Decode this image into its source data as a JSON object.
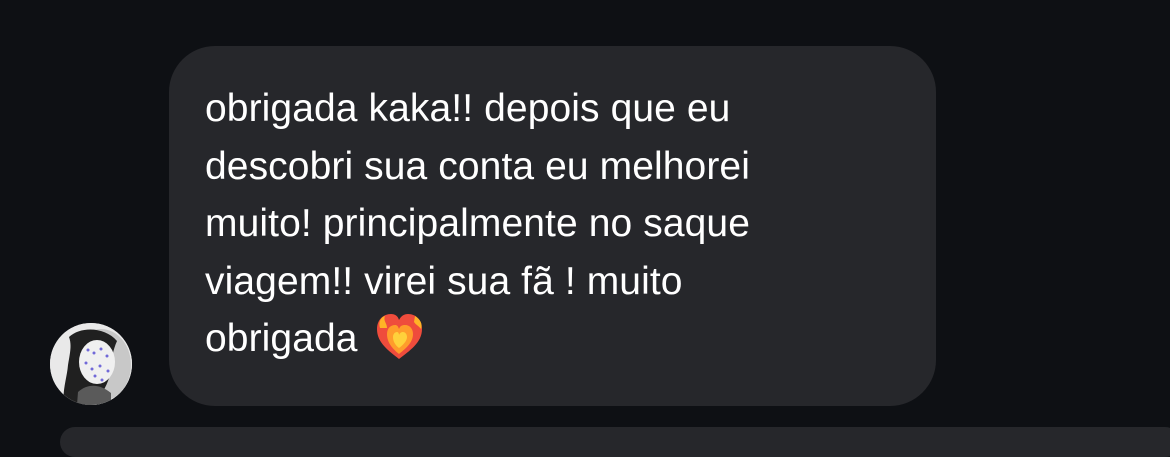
{
  "message": {
    "lines": [
      "obrigada kaka!! depois que eu",
      "descobri sua conta eu melhorei",
      "muito! principalmente no saque",
      "viagem!! virei sua fã ! muito",
      "obrigada"
    ],
    "emoji": "heart-on-fire"
  },
  "colors": {
    "background": "#0e1014",
    "bubble": "#26272b",
    "text": "#ffffff",
    "heart": "#ef4c3c",
    "flame": "#ffb326"
  },
  "avatar": {
    "icon": "profile-photo"
  }
}
